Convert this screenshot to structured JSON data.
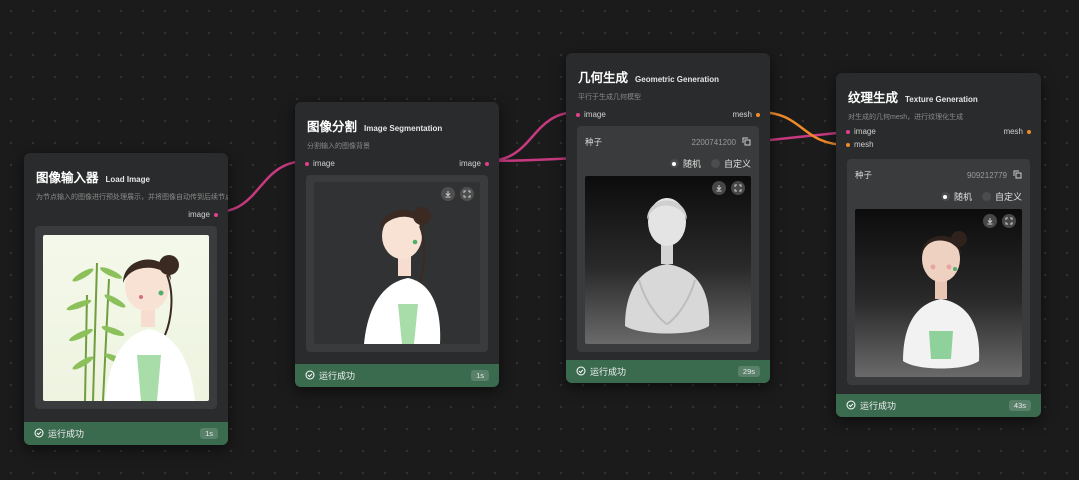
{
  "colors": {
    "canvas": "#1b1b1b",
    "node": "#2a2b2c",
    "success": "#3b6b4f",
    "image_port": "#e0408c",
    "mesh_port": "#f08b2a"
  },
  "nodes": {
    "load_image": {
      "title_cn": "图像输入器",
      "title_en": "Load Image",
      "desc": "为节点输入的图像进行预处理展示，并将图像自动传到后续节点",
      "output": "image",
      "status": "运行成功",
      "time": "1s"
    },
    "segmentation": {
      "title_cn": "图像分割",
      "title_en": "Image Segmentation",
      "desc": "分割输入的图像背景",
      "input": "image",
      "output": "image",
      "status": "运行成功",
      "time": "1s"
    },
    "geometric": {
      "title_cn": "几何生成",
      "title_en": "Geometric Generation",
      "desc": "平行于生成几何模型",
      "input": "image",
      "output": "mesh",
      "seed_label": "种子",
      "seed_value": "2200741200",
      "radio_random": "随机",
      "radio_custom": "自定义",
      "status": "运行成功",
      "time": "29s"
    },
    "texture": {
      "title_cn": "纹理生成",
      "title_en": "Texture Generation",
      "desc": "对生成的几何mesh，进行纹理化生成",
      "input_image": "image",
      "input_mesh": "mesh",
      "output": "mesh",
      "seed_label": "种子",
      "seed_value": "909212779",
      "radio_random": "随机",
      "radio_custom": "自定义",
      "status": "运行成功",
      "time": "43s"
    }
  },
  "icons": [
    "download-icon",
    "fullscreen-icon",
    "copy-icon",
    "check-circle-icon"
  ]
}
